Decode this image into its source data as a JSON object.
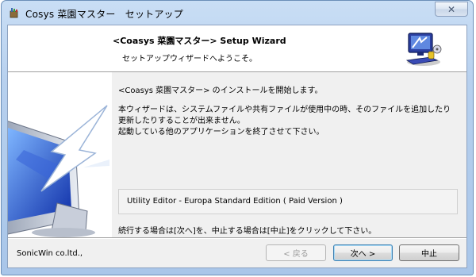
{
  "window": {
    "title": "Cosys 菜園マスター　セットアップ",
    "close_symbol": "✕"
  },
  "header": {
    "title": "<Coasys 菜園マスター> Setup Wizard",
    "subtitle": "セットアップウィザードへようこそ。",
    "icon": "computer-setup-icon"
  },
  "content": {
    "lines": [
      "<Coasys 菜園マスター> のインストールを開始します。",
      "本ウィザードは、システムファイルや共有ファイルが使用中の時、そのファイルを追加したり",
      "更新したりすることが出来ません。",
      "起動している他のアプリケーションを終了させて下さい。"
    ],
    "edition": "Utility Editor - Europa Standard Edition ( Paid Version )",
    "instruction": "続行する場合は[次へ]を、中止する場合は[中止]をクリックして下さい。"
  },
  "footer": {
    "company": "SonicWin co.ltd.,",
    "back_label": "< 戻る",
    "next_label": "次へ >",
    "cancel_label": "中止"
  },
  "colors": {
    "title_bar": "#b7d0ee",
    "dialog_bg": "#f0f0f0",
    "default_button_border": "#3c7fb1"
  }
}
